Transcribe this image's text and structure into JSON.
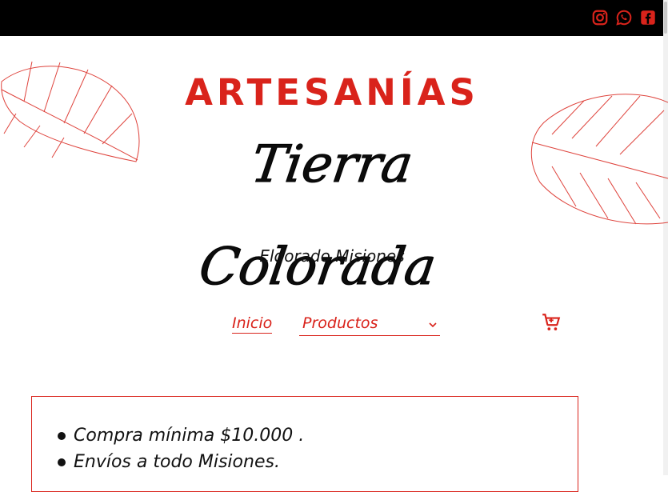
{
  "colors": {
    "brand_red": "#d9231b",
    "topbar": "#000000",
    "text": "#111111"
  },
  "social_links": [
    {
      "name": "instagram",
      "icon": "instagram-icon"
    },
    {
      "name": "whatsapp",
      "icon": "whatsapp-icon"
    },
    {
      "name": "facebook",
      "icon": "facebook-icon"
    }
  ],
  "brand": {
    "name_top": "ARTESANÍAS",
    "name_script": "Tierra Colorada",
    "location": "Eldorado Misiones"
  },
  "nav": {
    "home_label": "Inicio",
    "products_label": "Productos",
    "cart_icon": "cart-icon"
  },
  "info": {
    "items": [
      "Compra mínima $10.000 .",
      "Envíos a todo Misiones."
    ]
  }
}
